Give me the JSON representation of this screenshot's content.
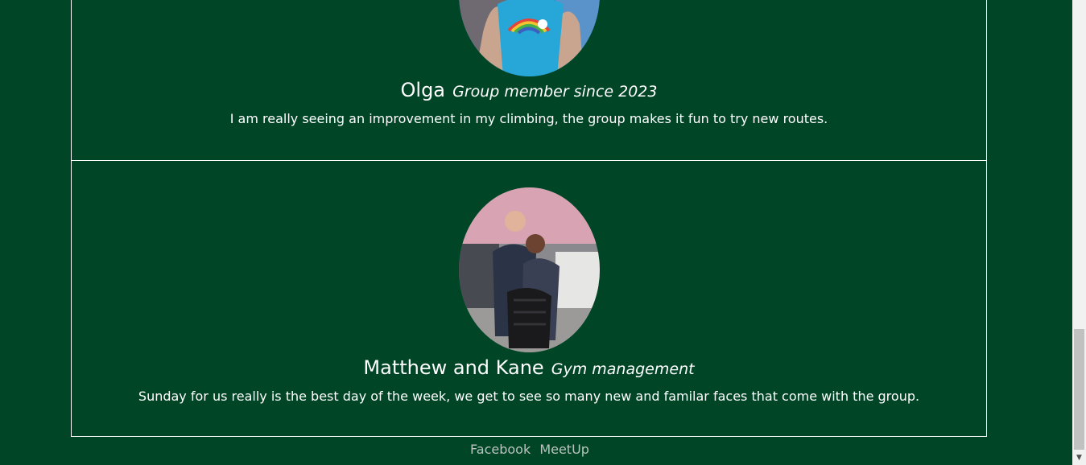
{
  "testimonials": [
    {
      "name": "Olga",
      "role": "Group member since 2023",
      "quote": "I am really seeing an improvement in my climbing, the group makes it fun to try new routes."
    },
    {
      "name": "Matthew and Kane",
      "role": "Gym management",
      "quote": "Sunday for us really is the best day of the week, we get to see so many new and familar faces that come with the group."
    }
  ],
  "footer": {
    "links": [
      "Facebook",
      "MeetUp"
    ]
  },
  "colors": {
    "background": "#004526",
    "text": "#ffffff",
    "footer_link": "#b9c4be"
  }
}
